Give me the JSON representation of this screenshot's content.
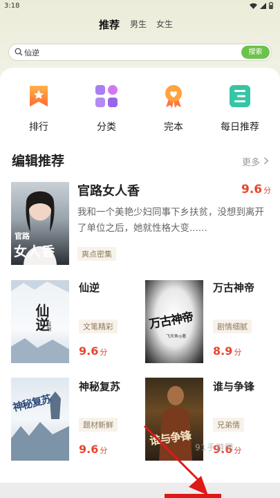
{
  "status_bar": {
    "time": "3:18"
  },
  "tabs": [
    "推荐",
    "男生",
    "女生"
  ],
  "search": {
    "value": "仙逆",
    "button": "搜索"
  },
  "categories": [
    {
      "label": "排行",
      "icon": "ranking-icon"
    },
    {
      "label": "分类",
      "icon": "category-icon"
    },
    {
      "label": "完本",
      "icon": "finished-icon"
    },
    {
      "label": "每日推荐",
      "icon": "daily-recommend-icon"
    }
  ],
  "section": {
    "title": "编辑推荐",
    "more": "更多"
  },
  "featured": {
    "title": "官路女人香",
    "score": "9.6",
    "unit": "分",
    "desc": "我和一个美艳少妇同事下乡扶贫，没想到离开了单位之后，她就性格大变......",
    "tag": "爽点密集",
    "cover_text_small": "官路",
    "cover_text_big": "女人香"
  },
  "books": [
    {
      "title": "仙逆",
      "tag": "文笔精彩",
      "score": "9.6",
      "unit": "分",
      "cover_text": "仙逆",
      "cover_sub": "耳根"
    },
    {
      "title": "万古神帝",
      "tag": "剧情细腻",
      "score": "8.9",
      "unit": "分",
      "cover_text": "万古神帝",
      "cover_sub": "飞天鱼◎著"
    },
    {
      "title": "神秘复苏",
      "tag": "题材新鲜",
      "score": "9.6",
      "unit": "分",
      "cover_text": "神秘复苏"
    },
    {
      "title": "谁与争锋",
      "tag": "兄弟情",
      "score": "9.6",
      "unit": "分",
      "cover_text": "谁与争锋"
    }
  ],
  "watermark": "91手游网",
  "colors": {
    "accent_green": "#6cc24a",
    "score_red": "#e8452e",
    "annotation_red": "#e01818"
  }
}
